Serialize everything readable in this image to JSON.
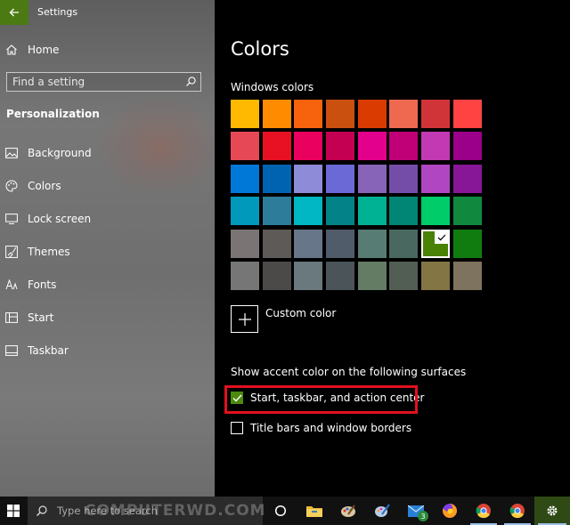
{
  "window": {
    "title": "Settings"
  },
  "sidebar": {
    "home_label": "Home",
    "search_placeholder": "Find a setting",
    "section_header": "Personalization",
    "items": [
      {
        "label": "Background",
        "icon": "image-icon"
      },
      {
        "label": "Colors",
        "icon": "palette-icon"
      },
      {
        "label": "Lock screen",
        "icon": "monitor-icon"
      },
      {
        "label": "Themes",
        "icon": "brush-icon"
      },
      {
        "label": "Fonts",
        "icon": "font-icon"
      },
      {
        "label": "Start",
        "icon": "start-layout-icon"
      },
      {
        "label": "Taskbar",
        "icon": "taskbar-icon"
      }
    ]
  },
  "main": {
    "title": "Colors",
    "windows_colors_label": "Windows colors",
    "swatches": [
      "#FFB900",
      "#FF8C00",
      "#F7630C",
      "#CA5010",
      "#DA3B01",
      "#EF6950",
      "#D13438",
      "#FF4343",
      "#E74856",
      "#E81123",
      "#EA005E",
      "#C30052",
      "#E3008C",
      "#BF0077",
      "#C239B3",
      "#9A0089",
      "#0078D7",
      "#0063B1",
      "#8E8CD8",
      "#6B69D6",
      "#8764B8",
      "#744DA9",
      "#B146C2",
      "#881798",
      "#0099BC",
      "#2D7D9A",
      "#00B7C3",
      "#038387",
      "#00B294",
      "#018574",
      "#00CC6A",
      "#10893E",
      "#7A7574",
      "#5D5A58",
      "#68768A",
      "#515C6B",
      "#567C73",
      "#486860",
      "#498205",
      "#107C10",
      "#767676",
      "#4C4A48",
      "#69797E",
      "#4A5459",
      "#647C64",
      "#525E54",
      "#847545",
      "#7E735F"
    ],
    "selected_swatch_index": 38,
    "custom_color_label": "Custom color",
    "surfaces_label": "Show accent color on the following surfaces",
    "checkbox_start": {
      "label": "Start, taskbar, and action center",
      "checked": true
    },
    "checkbox_titlebars": {
      "label": "Title bars and window borders",
      "checked": false
    }
  },
  "taskbar": {
    "search_placeholder": "Type here to search",
    "watermark": "COMPUTERWD.COM",
    "mail_badge": "3"
  },
  "colors": {
    "accent": "#4C8A0E",
    "highlight_border": "#E3101E"
  }
}
